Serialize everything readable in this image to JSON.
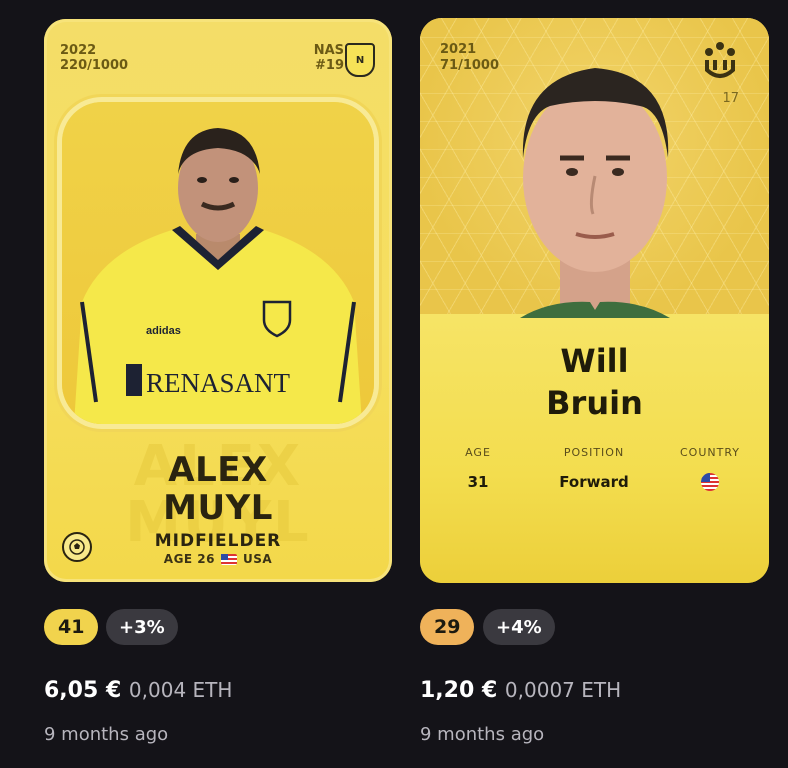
{
  "cards": [
    {
      "season": "2022",
      "serial": "220/1000",
      "team_code": "NAS",
      "team_number": "#19",
      "club_badge_letter": "N",
      "sponsor_text": "RENASANT",
      "first_name": "ALEX",
      "last_name": "MUYL",
      "position": "MIDFIELDER",
      "age_label": "AGE 26",
      "country": "USA",
      "score": "41",
      "score_color": "#f1d34d",
      "delta": "+3%",
      "price_eur": "6,05 €",
      "price_eth": "0,004 ETH",
      "time_ago": "9 months ago",
      "icons": [
        "club-badge-icon",
        "soccer-ball-icon",
        "us-flag-icon"
      ]
    },
    {
      "season": "2021",
      "serial": "71/1000",
      "league_number": "17",
      "first_name": "Will",
      "last_name": "Bruin",
      "stats": {
        "age_label": "AGE",
        "age_value": "31",
        "position_label": "POSITION",
        "position_value": "Forward",
        "country_label": "COUNTRY"
      },
      "score": "29",
      "score_color": "#efb25a",
      "delta": "+4%",
      "price_eur": "1,20 €",
      "price_eth": "0,0007 ETH",
      "time_ago": "9 months ago",
      "icons": [
        "league-logo-icon",
        "us-flag-icon"
      ]
    }
  ]
}
